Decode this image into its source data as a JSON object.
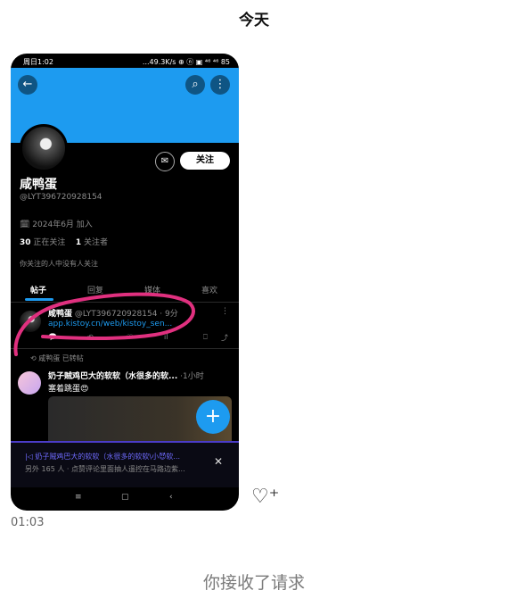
{
  "header": {
    "date": "今天"
  },
  "phone": {
    "status_left": "周日1:02",
    "status_right": "...49.3K/s ⊕ ⓝ ▣ ⁴⁶ ⁴⁶ 85",
    "profile": {
      "display_name": "咸鸭蛋",
      "handle": "@LYT396720928154",
      "joined": "🗓 2024年6月 加入",
      "following_count": "30",
      "following_label": "正在关注",
      "followers_count": "1",
      "followers_label": "关注者",
      "mutual_note": "你关注的人中没有人关注",
      "follow_label": "关注"
    },
    "tabs": [
      "帖子",
      "回复",
      "媒体",
      "喜欢"
    ],
    "post1": {
      "author": "咸鸭蛋",
      "meta": "@LYT396720928154 · 9分",
      "link": "app.kistoy.cn/web/kistoy_sen..."
    },
    "repost_note": "咸鸭蛋 已转帖",
    "post2": {
      "title": "奶子贼鸡巴大的软软（水很多的软...",
      "meta": "·1小时",
      "body": "塞着跳蛋😍"
    },
    "media_bar": {
      "title": "|◁ 奶子贼鸡巴大的软软（水很多的软软\\小😈软...",
      "subtitle": "另外 165 人 · 点赞评论里面抽人遥控在马路边紫..."
    },
    "accent_color": "#1d9bf0",
    "highlight_color": "#e0307f"
  },
  "chat": {
    "time": "01:03",
    "request_note": "你接收了请求"
  }
}
